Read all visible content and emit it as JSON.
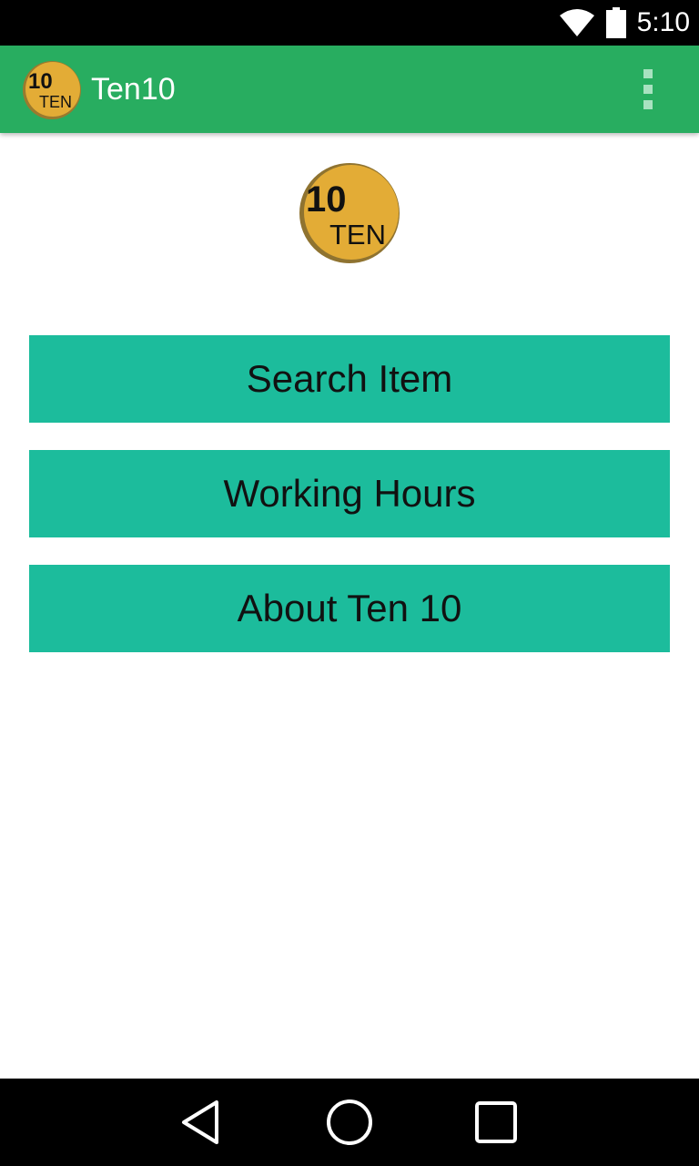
{
  "status_bar": {
    "time": "5:10",
    "icons": [
      "wifi-icon",
      "battery-icon"
    ]
  },
  "app_bar": {
    "logo_number": "10",
    "logo_word": "TEN",
    "title": "Ten10",
    "menu_icon": "overflow-menu-icon"
  },
  "main": {
    "logo_number": "10",
    "logo_word": "TEN",
    "buttons": [
      {
        "label": "Search Item"
      },
      {
        "label": "Working Hours"
      },
      {
        "label": "About Ten 10"
      }
    ]
  },
  "nav_bar": {
    "icons": [
      "back-icon",
      "home-icon",
      "recents-icon"
    ]
  },
  "colors": {
    "status_bar": "#000000",
    "app_bar": "#28ad60",
    "button": "#1cbc9c",
    "logo_gold": "#e3ac36",
    "nav_bar": "#000000"
  }
}
